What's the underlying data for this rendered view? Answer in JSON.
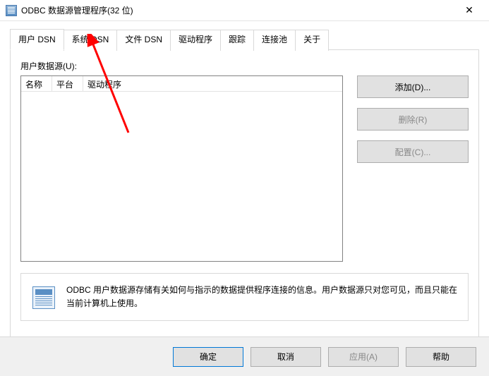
{
  "window": {
    "title": "ODBC 数据源管理程序(32 位)"
  },
  "tabs": {
    "user_dsn": "用户 DSN",
    "system_dsn": "系统 DSN",
    "file_dsn": "文件 DSN",
    "drivers": "驱动程序",
    "tracing": "跟踪",
    "connection_pooling": "连接池",
    "about": "关于"
  },
  "panel": {
    "list_label": "用户数据源(U):",
    "columns": {
      "name": "名称",
      "platform": "平台",
      "driver": "驱动程序"
    }
  },
  "side_buttons": {
    "add": "添加(D)...",
    "remove": "删除(R)",
    "configure": "配置(C)..."
  },
  "info_text": "ODBC 用户数据源存储有关如何与指示的数据提供程序连接的信息。用户数据源只对您可见，而且只能在当前计算机上使用。",
  "bottom": {
    "ok": "确定",
    "cancel": "取消",
    "apply": "应用(A)",
    "help": "帮助"
  }
}
